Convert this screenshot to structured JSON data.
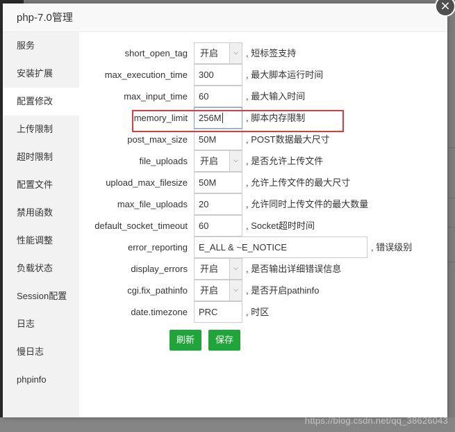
{
  "dialog": {
    "title": "php-7.0管理",
    "close_icon": "×"
  },
  "sidebar": {
    "items": [
      "服务",
      "安装扩展",
      "配置修改",
      "上传限制",
      "超时限制",
      "配置文件",
      "禁用函数",
      "性能调整",
      "负载状态",
      "Session配置",
      "日志",
      "慢日志",
      "phpinfo"
    ],
    "active": "配置修改"
  },
  "form": {
    "rows": [
      {
        "key": "short_open_tag",
        "value": "开启",
        "type": "select",
        "desc": ", 短标签支持"
      },
      {
        "key": "max_execution_time",
        "value": "300",
        "type": "input",
        "desc": ", 最大脚本运行时间"
      },
      {
        "key": "max_input_time",
        "value": "60",
        "type": "input",
        "desc": ", 最大输入时间"
      },
      {
        "key": "memory_limit",
        "value": "256M",
        "type": "input",
        "desc": ", 脚本内存限制",
        "focused": true
      },
      {
        "key": "post_max_size",
        "value": "50M",
        "type": "input",
        "desc": ", POST数据最大尺寸"
      },
      {
        "key": "file_uploads",
        "value": "开启",
        "type": "select",
        "desc": ", 是否允许上传文件"
      },
      {
        "key": "upload_max_filesize",
        "value": "50M",
        "type": "input",
        "desc": ", 允许上传文件的最大尺寸"
      },
      {
        "key": "max_file_uploads",
        "value": "20",
        "type": "input",
        "desc": ", 允许同时上传文件的最大数量"
      },
      {
        "key": "default_socket_timeout",
        "value": "60",
        "type": "input",
        "desc": ", Socket超时时间"
      },
      {
        "key": "error_reporting",
        "value": "E_ALL & ~E_NOTICE",
        "type": "input-wide",
        "desc": ", 错误级别"
      },
      {
        "key": "display_errors",
        "value": "开启",
        "type": "select",
        "desc": ", 是否输出详细错误信息"
      },
      {
        "key": "cgi.fix_pathinfo",
        "value": "开启",
        "type": "select",
        "desc": ", 是否开启pathinfo"
      },
      {
        "key": "date.timezone",
        "value": "PRC",
        "type": "input",
        "desc": ", 时区"
      }
    ],
    "refresh_label": "刷新",
    "save_label": "保存"
  },
  "colors": {
    "accent_green": "#20a53a",
    "highlight_red": "#e0393e"
  },
  "watermark": "https://blog.csdn.net/qq_38626043"
}
